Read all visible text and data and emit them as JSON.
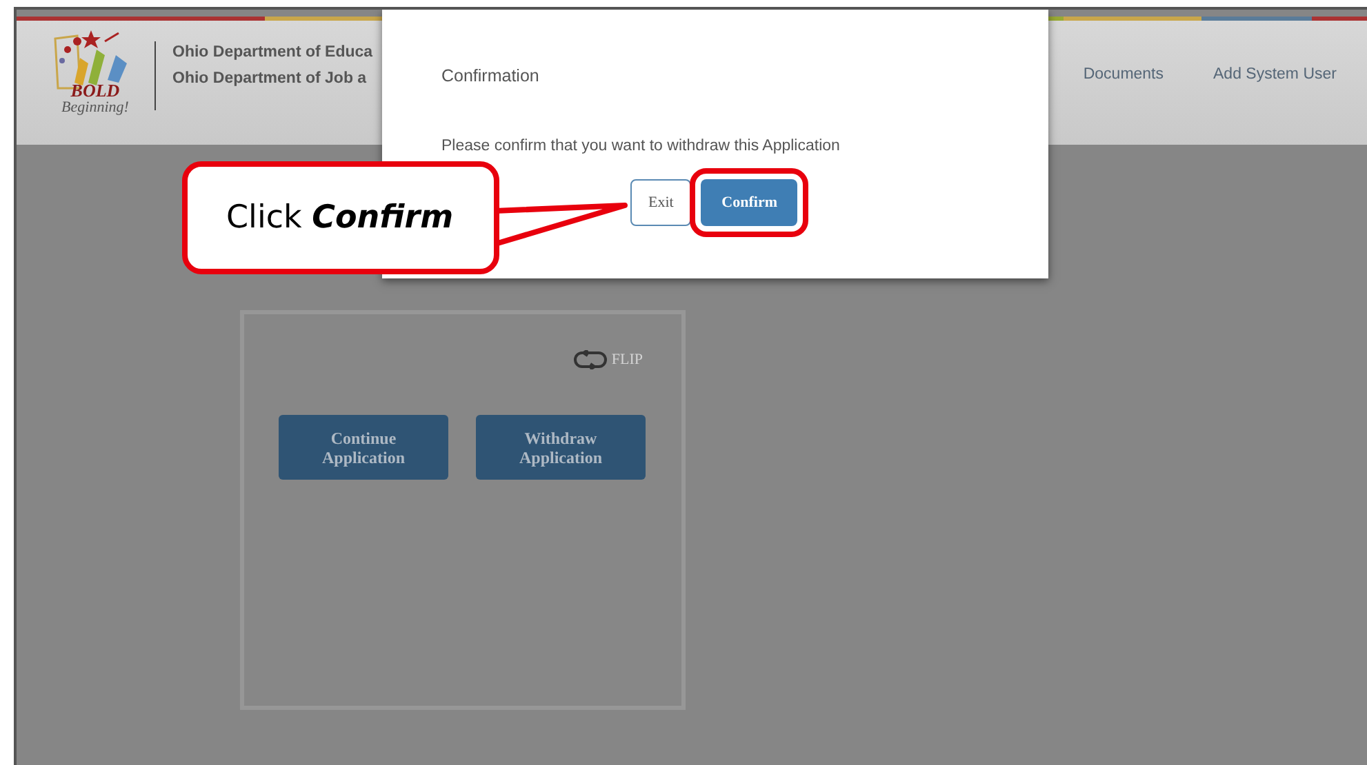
{
  "header": {
    "logo": {
      "word1": "BOLD",
      "word2": "Beginning!"
    },
    "org_lines": [
      "Ohio Department of Educa",
      "Ohio Department of Job a"
    ],
    "nav": [
      "Documents",
      "Add System User"
    ]
  },
  "card": {
    "flip_label": "FLIP",
    "buttons": [
      "Continue Application",
      "Withdraw Application"
    ]
  },
  "modal": {
    "title": "Confirmation",
    "message": "Please confirm that you want to withdraw this Application",
    "buttons": [
      {
        "label": "Exit",
        "kind": "secondary",
        "highlighted": false
      },
      {
        "label": "Confirm",
        "kind": "primary",
        "highlighted": true
      }
    ]
  },
  "callout": {
    "text": "Click *Confirm*"
  }
}
